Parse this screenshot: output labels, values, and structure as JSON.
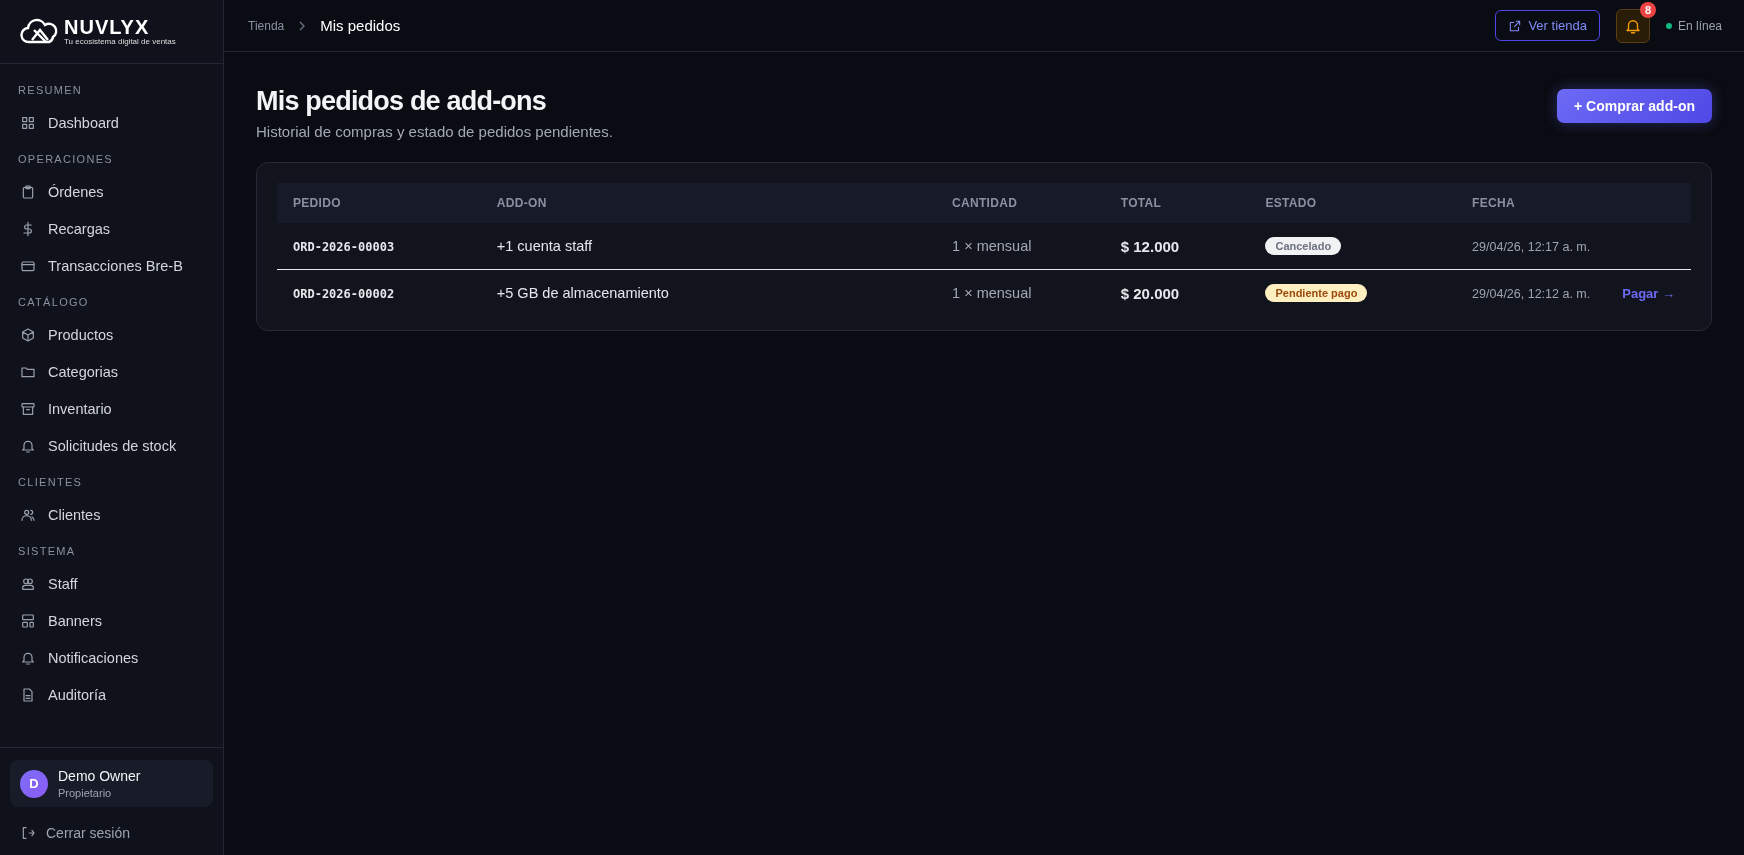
{
  "sidebar": {
    "logo": {
      "name": "NUVLYX",
      "tagline": "Tu ecosistema digital de ventas"
    },
    "sections": [
      {
        "title": "RESUMEN",
        "items": [
          {
            "label": "Dashboard"
          }
        ]
      },
      {
        "title": "OPERACIONES",
        "items": [
          {
            "label": "Órdenes"
          },
          {
            "label": "Recargas"
          },
          {
            "label": "Transacciones Bre-B"
          }
        ]
      },
      {
        "title": "CATÁLOGO",
        "items": [
          {
            "label": "Productos"
          },
          {
            "label": "Categorias"
          },
          {
            "label": "Inventario"
          },
          {
            "label": "Solicitudes de stock"
          }
        ]
      },
      {
        "title": "CLIENTES",
        "items": [
          {
            "label": "Clientes"
          }
        ]
      },
      {
        "title": "SISTEMA",
        "items": [
          {
            "label": "Staff"
          },
          {
            "label": "Banners"
          },
          {
            "label": "Notificaciones"
          },
          {
            "label": "Auditoría"
          }
        ]
      }
    ],
    "user": {
      "initial": "D",
      "name": "Demo Owner",
      "role": "Propietario"
    },
    "logout": "Cerrar sesión"
  },
  "topbar": {
    "breadcrumb": [
      "Tienda",
      "Mis pedidos"
    ],
    "store_button": "Ver tienda",
    "notifications": "8",
    "status": "En línea"
  },
  "page": {
    "title": "Mis pedidos de add-ons",
    "subtitle": "Historial de compras y estado de pedidos pendientes.",
    "action": "+ Comprar add-on"
  },
  "table": {
    "columns": [
      "PEDIDO",
      "ADD-ON",
      "CANTIDAD",
      "TOTAL",
      "ESTADO",
      "FECHA"
    ],
    "rows": [
      {
        "order": "ORD-2026-00003",
        "addon": "+1 cuenta staff",
        "quantity": "1 × mensual",
        "total": "$ 12.000",
        "status": {
          "label": "Cancelado",
          "kind": "cancelled"
        },
        "date": "29/04/26, 12:17 a. m."
      },
      {
        "order": "ORD-2026-00002",
        "addon": "+5 GB de almacenamiento",
        "quantity": "1 × mensual",
        "total": "$ 20.000",
        "status": {
          "label": "Pendiente pago",
          "kind": "pending"
        },
        "date": "29/04/26, 12:12 a. m.",
        "action": "Pagar →"
      }
    ]
  }
}
